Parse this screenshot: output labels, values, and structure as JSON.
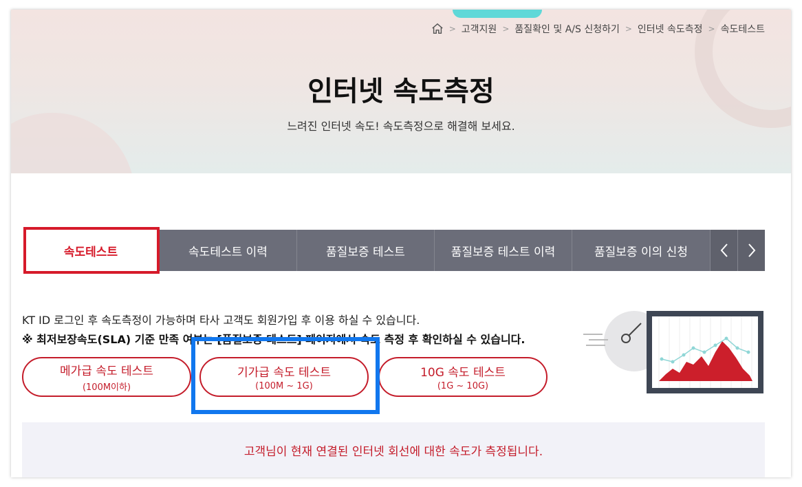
{
  "breadcrumb": {
    "home_icon": "home-icon",
    "items": [
      "고객지원",
      "품질확인 및 A/S 신청하기",
      "인터넷 속도측정",
      "속도테스트"
    ]
  },
  "hero": {
    "title": "인터넷 속도측정",
    "subtitle": "느려진 인터넷 속도! 속도측정으로 해결해 보세요."
  },
  "tabs": {
    "items": [
      "속도테스트",
      "속도테스트 이력",
      "품질보증 테스트",
      "품질보증 테스트 이력",
      "품질보증 이의 신청"
    ],
    "active_index": 0,
    "prev_icon": "chevron-left-icon",
    "next_icon": "chevron-right-icon"
  },
  "notice": {
    "line1": "KT ID 로그인 후 속도측정이 가능하며 타사 고객도 회원가입 후 이용 하실 수 있습니다.",
    "line2": "※ 최저보장속도(SLA) 기준 만족 여부는 [품질보증 테스트] 페이지에서 속도 측정 후 확인하실 수 있습니다."
  },
  "test_buttons": [
    {
      "label": "메가급 속도 테스트",
      "sub": "(100M이하)"
    },
    {
      "label": "기가급 속도 테스트",
      "sub": "(100M ~ 1G)"
    },
    {
      "label": "10G 속도 테스트",
      "sub": "(1G ~ 10G)"
    }
  ],
  "info": {
    "text": "고객님이 현재 연결된 인터넷 회선에 대한 속도가 측정됩니다."
  },
  "colors": {
    "accent": "#d61a2a",
    "tab_bg": "#6b6d79",
    "highlight_blue": "#1177ee",
    "info_bg": "#f2f2f8"
  }
}
